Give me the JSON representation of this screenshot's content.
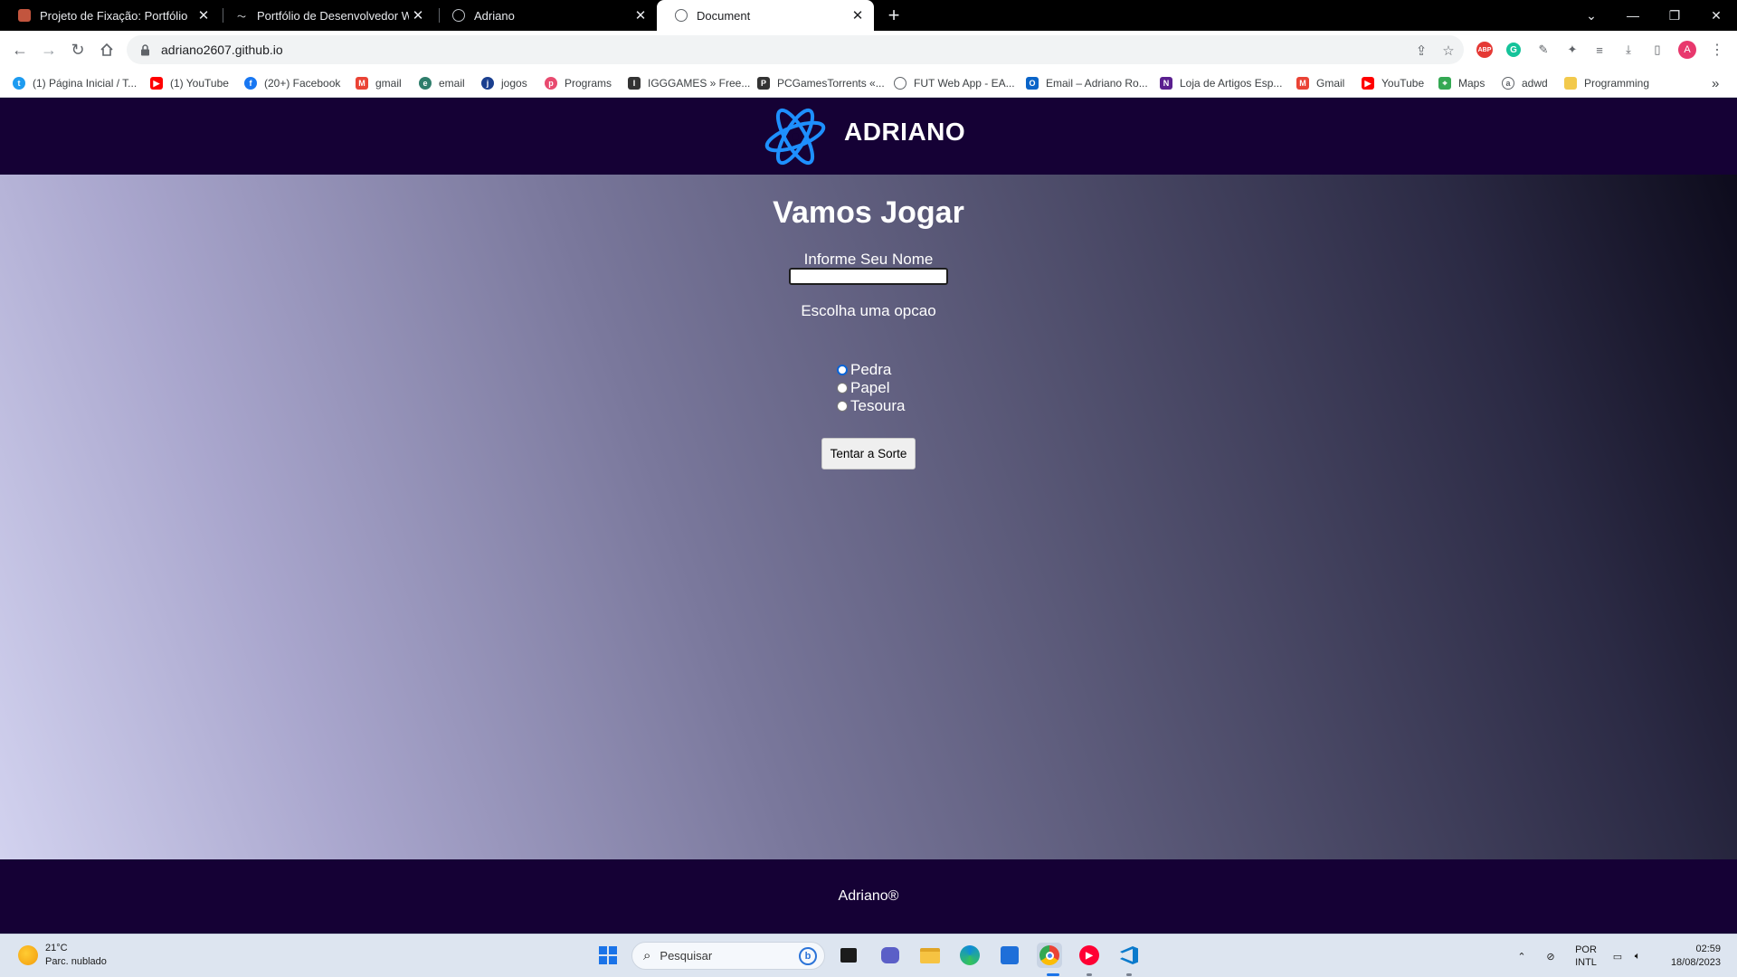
{
  "browser": {
    "tabs": [
      {
        "title": "Projeto de Fixação: Portfólio",
        "icon": "bookmark-red-icon",
        "active": false
      },
      {
        "title": "Portfólio de Desenvolvedor Web",
        "icon": "signature-icon",
        "active": false
      },
      {
        "title": "Adriano",
        "icon": "globe-icon",
        "active": false
      },
      {
        "title": "Document",
        "icon": "globe-icon",
        "active": true
      }
    ],
    "new_tab_symbol": "+",
    "address": "adriano2607.github.io",
    "bookmarks": [
      {
        "label": "(1) Página Inicial / T...",
        "icon": "twitter-icon",
        "color": "#1d9bf0"
      },
      {
        "label": "(1) YouTube",
        "icon": "youtube-icon",
        "color": "#ff0000"
      },
      {
        "label": "(20+) Facebook",
        "icon": "facebook-icon",
        "color": "#1877f2"
      },
      {
        "label": "gmail",
        "icon": "gmail-icon",
        "color": "#ea4335"
      },
      {
        "label": "email",
        "icon": "email-icon",
        "color": "#2e7d6b"
      },
      {
        "label": "jogos",
        "icon": "jogos-icon",
        "color": "#1a3f8f"
      },
      {
        "label": "Programs",
        "icon": "programs-icon",
        "color": "#e84a6f"
      },
      {
        "label": "IGGGAMES » Free...",
        "icon": "igg-icon",
        "color": "#333333"
      },
      {
        "label": "PCGamesTorrents «...",
        "icon": "pcgt-icon",
        "color": "#333333"
      },
      {
        "label": "FUT Web App - EA...",
        "icon": "globe-icon",
        "color": "#5f6368"
      },
      {
        "label": "Email – Adriano Ro...",
        "icon": "outlook-icon",
        "color": "#0a64c8"
      },
      {
        "label": "Loja de Artigos Esp...",
        "icon": "netshoes-icon",
        "color": "#5a1f8f"
      },
      {
        "label": "Gmail",
        "icon": "gmail-icon",
        "color": "#ea4335"
      },
      {
        "label": "YouTube",
        "icon": "youtube-icon",
        "color": "#ff0000"
      },
      {
        "label": "Maps",
        "icon": "maps-icon",
        "color": "#34a853"
      },
      {
        "label": "adwd",
        "icon": "adwd-icon",
        "color": "#5f6368"
      },
      {
        "label": "Programming",
        "icon": "folder-icon",
        "color": "#f2c94c"
      }
    ],
    "bookmarks_overflow": "»"
  },
  "site": {
    "brand": "ADRIANO",
    "title": "Vamos Jogar",
    "name_label": "Informe Seu Nome",
    "name_value": "",
    "choose_label": "Escolha uma opcao",
    "options": [
      {
        "label": "Pedra",
        "checked": true
      },
      {
        "label": "Papel",
        "checked": false
      },
      {
        "label": "Tesoura",
        "checked": false
      }
    ],
    "button_label": "Tentar a Sorte",
    "footer": "Adriano®",
    "colors": {
      "header_bg": "#150135",
      "logo": "#1e90ff"
    }
  },
  "taskbar": {
    "weather_temp": "21°C",
    "weather_desc": "Parc. nublado",
    "search_placeholder": "Pesquisar",
    "lang_1": "POR",
    "lang_2": "INTL",
    "time": "02:59",
    "date": "18/08/2023"
  }
}
